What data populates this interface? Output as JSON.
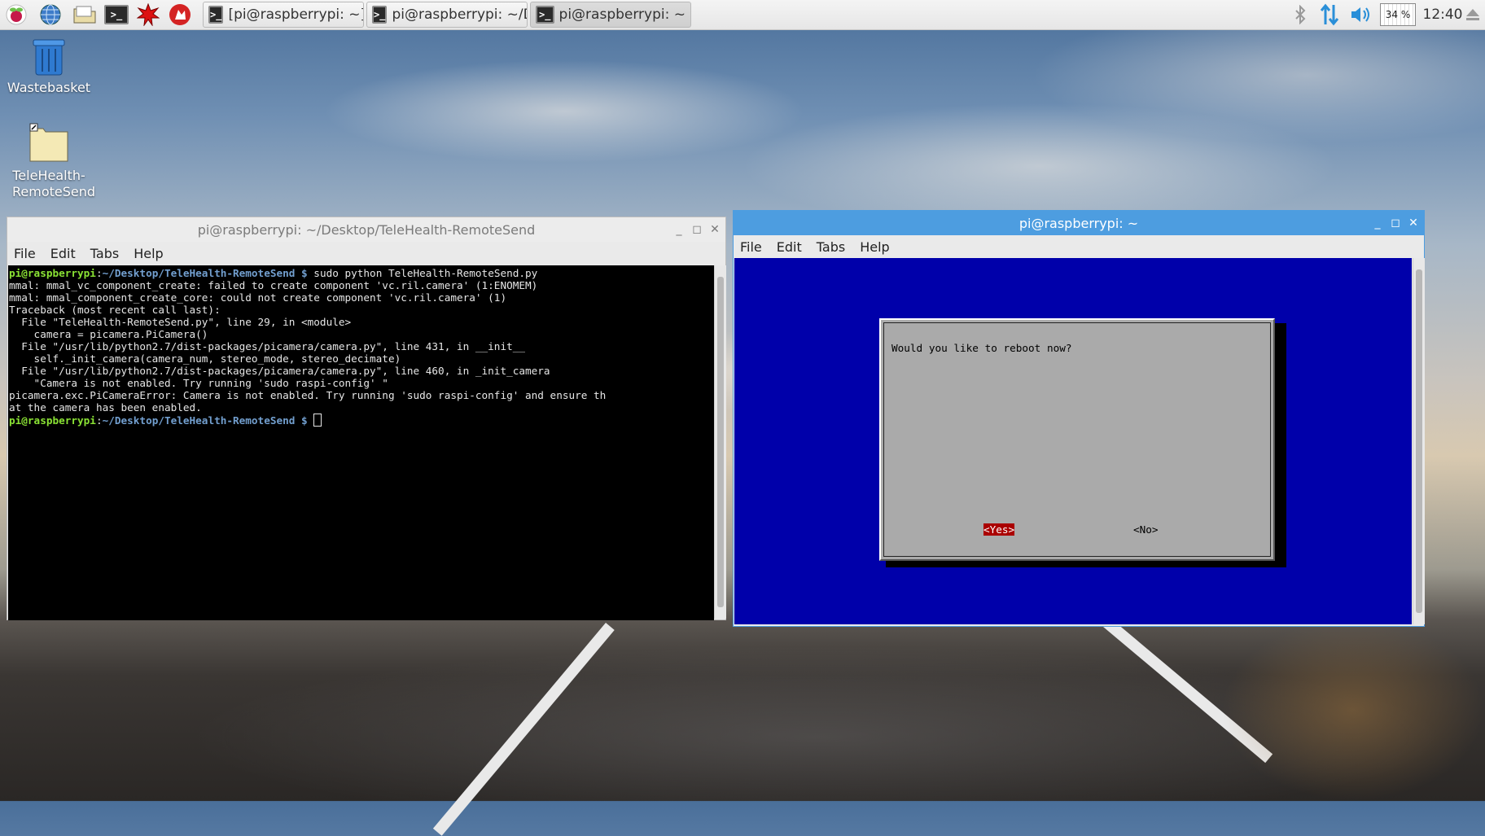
{
  "taskbar": {
    "launchers": [
      "raspberry-menu-icon",
      "web-browser-icon",
      "file-manager-icon",
      "terminal-icon",
      "mathematica-icon",
      "wolfram-icon"
    ],
    "tasks": [
      {
        "label": "[pi@raspberrypi: ~]",
        "active": false
      },
      {
        "label": "pi@raspberrypi: ~/D...",
        "active": false
      },
      {
        "label": "pi@raspberrypi: ~",
        "active": true
      }
    ],
    "tray": {
      "cpu": "34 %",
      "clock": "12:40"
    }
  },
  "desktop": {
    "icons": [
      {
        "label": "Wastebasket"
      },
      {
        "label": "TeleHealth-RemoteSend"
      }
    ]
  },
  "window_left": {
    "title": "pi@raspberrypi: ~/Desktop/TeleHealth-RemoteSend",
    "menu": [
      "File",
      "Edit",
      "Tabs",
      "Help"
    ],
    "prompt_user": "pi@raspberrypi",
    "prompt_path": "~/Desktop/TeleHealth-RemoteSend $",
    "command": " sudo python TeleHealth-RemoteSend.py",
    "output": [
      "mmal: mmal_vc_component_create: failed to create component 'vc.ril.camera' (1:ENOMEM)",
      "mmal: mmal_component_create_core: could not create component 'vc.ril.camera' (1)",
      "Traceback (most recent call last):",
      "  File \"TeleHealth-RemoteSend.py\", line 29, in <module>",
      "    camera = picamera.PiCamera()",
      "  File \"/usr/lib/python2.7/dist-packages/picamera/camera.py\", line 431, in __init__",
      "    self._init_camera(camera_num, stereo_mode, stereo_decimate)",
      "  File \"/usr/lib/python2.7/dist-packages/picamera/camera.py\", line 460, in _init_camera",
      "    \"Camera is not enabled. Try running 'sudo raspi-config' \"",
      "picamera.exc.PiCameraError: Camera is not enabled. Try running 'sudo raspi-config' and ensure th",
      "at the camera has been enabled."
    ],
    "prompt2_user": "pi@raspberrypi",
    "prompt2_path": "~/Desktop/TeleHealth-RemoteSend $"
  },
  "window_right": {
    "title": "pi@raspberrypi: ~",
    "menu": [
      "File",
      "Edit",
      "Tabs",
      "Help"
    ],
    "dialog": {
      "message": "Would you like to reboot now?",
      "yes_label": "<Yes>",
      "no_label": "<No>"
    }
  },
  "colors": {
    "titlebar_active": "#4d9de0",
    "terminal_bg": "#000000",
    "whiptail_bg": "#0000aa",
    "dialog_bg": "#aaaaaa",
    "yes_highlight": "#aa0000"
  }
}
